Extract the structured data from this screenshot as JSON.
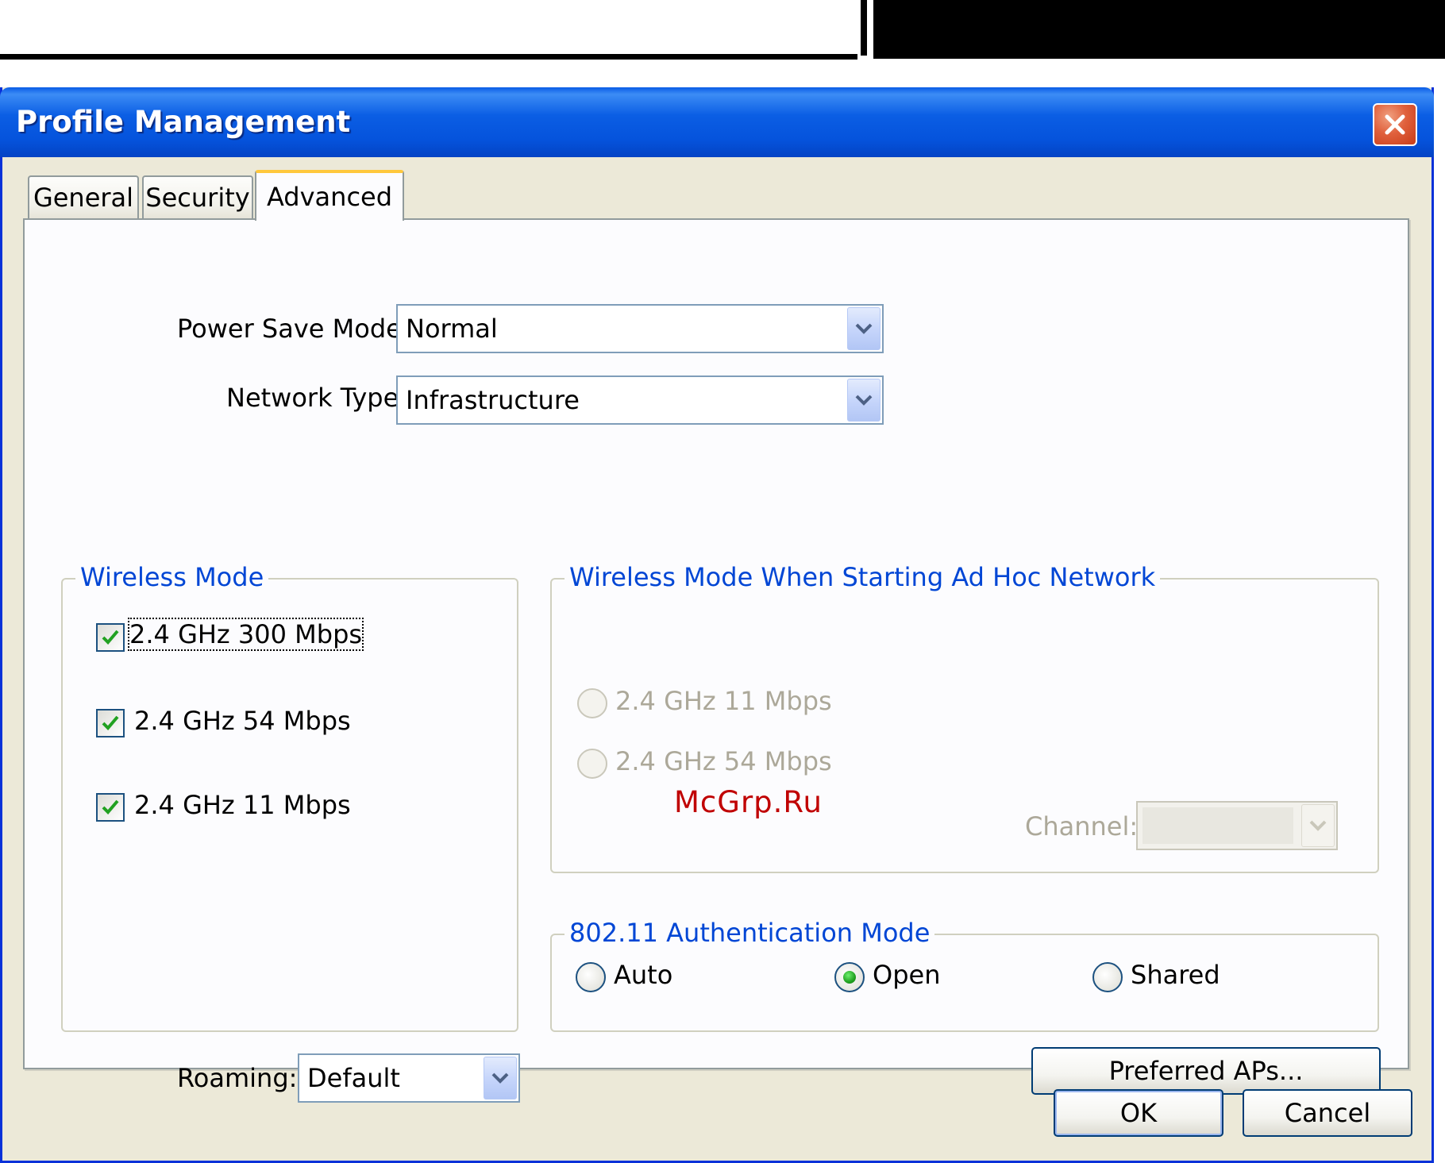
{
  "window": {
    "title": "Profile Management"
  },
  "tabs": [
    {
      "label": "General",
      "active": false
    },
    {
      "label": "Security",
      "active": false
    },
    {
      "label": "Advanced",
      "active": true
    }
  ],
  "power_save": {
    "label": "Power Save Mode:",
    "value": "Normal"
  },
  "network_type": {
    "label": "Network Type:",
    "value": "Infrastructure"
  },
  "wireless_mode": {
    "title": "Wireless Mode",
    "options": [
      {
        "label": "2.4 GHz 300 Mbps",
        "checked": true
      },
      {
        "label": "2.4 GHz 54 Mbps",
        "checked": true
      },
      {
        "label": "2.4 GHz 11 Mbps",
        "checked": true
      }
    ]
  },
  "adhoc_mode": {
    "title": "Wireless Mode When Starting Ad Hoc Network",
    "options": [
      {
        "label": "2.4 GHz 11 Mbps",
        "selected": false
      },
      {
        "label": "2.4 GHz 54 Mbps",
        "selected": false
      }
    ],
    "channel_label": "Channel:",
    "channel_value": ""
  },
  "auth_mode": {
    "title": "802.11 Authentication Mode",
    "options": [
      {
        "label": "Auto",
        "selected": false
      },
      {
        "label": "Open",
        "selected": true
      },
      {
        "label": "Shared",
        "selected": false
      }
    ]
  },
  "roaming": {
    "label": "Roaming:",
    "value": "Default"
  },
  "buttons": {
    "preferred_aps": "Preferred APs...",
    "ok": "OK",
    "cancel": "Cancel"
  },
  "watermark": "McGrp.Ru",
  "icons": {
    "close": "close-icon",
    "dropdown": "chevron-down-icon",
    "check": "checkmark-icon"
  },
  "colors": {
    "titlebar": "#0553dc",
    "group_title": "#0046d5",
    "check": "#21a121"
  }
}
